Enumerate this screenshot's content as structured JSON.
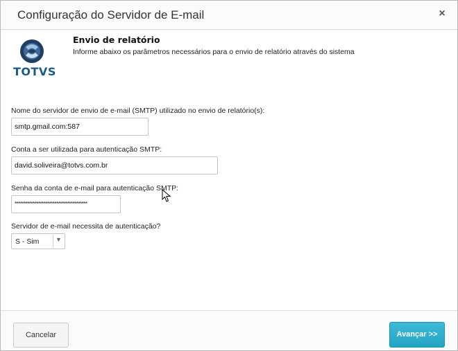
{
  "dialog": {
    "title": "Configuração do Servidor de E-mail",
    "close_glyph": "×"
  },
  "header": {
    "logo_text": "TOTVS",
    "title": "Envio de relatório",
    "description": "Informe abaixo os parâmetros necessários para o envio de relatório através do sistema"
  },
  "form": {
    "smtp_label": "Nome do servidor de envio de e-mail (SMTP) utilizado no envio de relatório(s):",
    "smtp_value": "smtp.gmail.com:587",
    "account_label": "Conta a ser utilizada para autenticação SMTP:",
    "account_value": "david.soliveira@totvs.com.br",
    "password_label": "Senha da conta de e-mail para autenticação SMTP:",
    "password_value": "****************************************",
    "auth_label": "Servidor de e-mail necessita de autenticação?",
    "auth_selected": "S - Sim"
  },
  "footer": {
    "cancel_label": "Cancelar",
    "next_label": "Avançar >>"
  },
  "colors": {
    "accent": "#2aa8c8",
    "logo_blue": "#1c5b86"
  }
}
